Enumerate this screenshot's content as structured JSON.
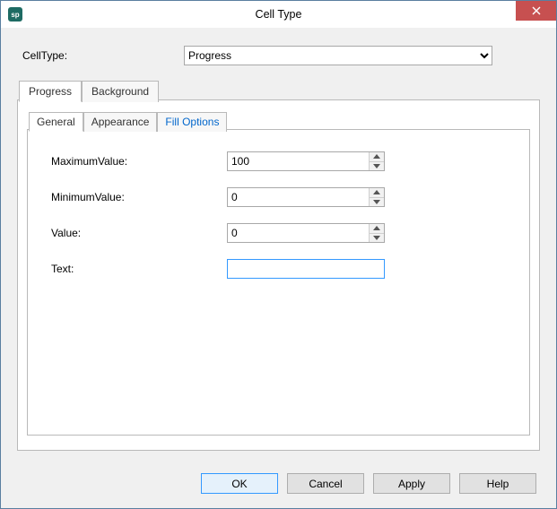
{
  "window": {
    "title": "Cell Type"
  },
  "cellType": {
    "label": "CellType:",
    "selected": "Progress"
  },
  "outerTabs": {
    "progress": "Progress",
    "background": "Background"
  },
  "innerTabs": {
    "general": "General",
    "appearance": "Appearance",
    "fillOptions": "Fill Options"
  },
  "fields": {
    "maximumValue": {
      "label": "MaximumValue:",
      "value": "100"
    },
    "minimumValue": {
      "label": "MinimumValue:",
      "value": "0"
    },
    "value": {
      "label": "Value:",
      "value": "0"
    },
    "text": {
      "label": "Text:",
      "value": ""
    }
  },
  "buttons": {
    "ok": "OK",
    "cancel": "Cancel",
    "apply": "Apply",
    "help": "Help"
  }
}
